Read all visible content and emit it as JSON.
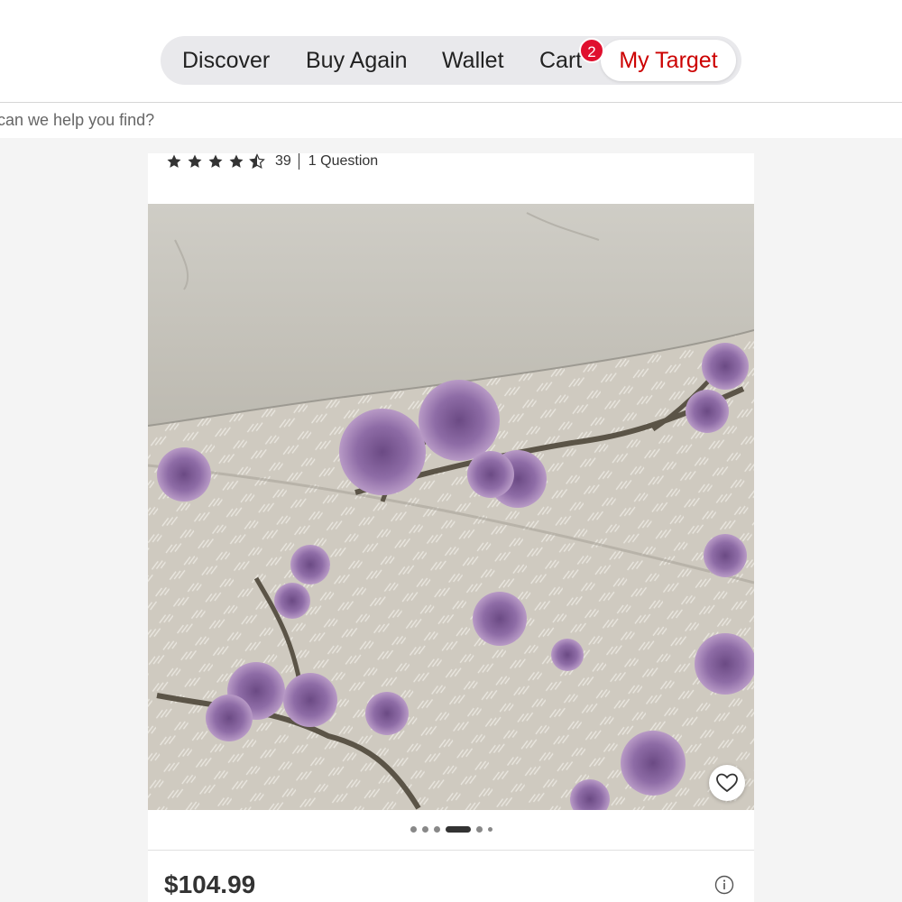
{
  "tabs": {
    "items": [
      {
        "label": "Discover"
      },
      {
        "label": "Buy Again"
      },
      {
        "label": "Wallet"
      },
      {
        "label": "Cart",
        "badge": "2"
      }
    ],
    "active": {
      "label": "My Target"
    },
    "active_color": "#cc0000",
    "badge_color": "#e0102e"
  },
  "search": {
    "placeholder": "What can we help you find?"
  },
  "product": {
    "rating": 4.5,
    "rating_count": "39",
    "questions": "1 Question",
    "image_icon": "floral-comforter-photo",
    "favorite_icon": "heart-icon",
    "carousel": {
      "total": 6,
      "active_index": 3
    },
    "price": "$104.99",
    "info_icon": "info-icon"
  }
}
